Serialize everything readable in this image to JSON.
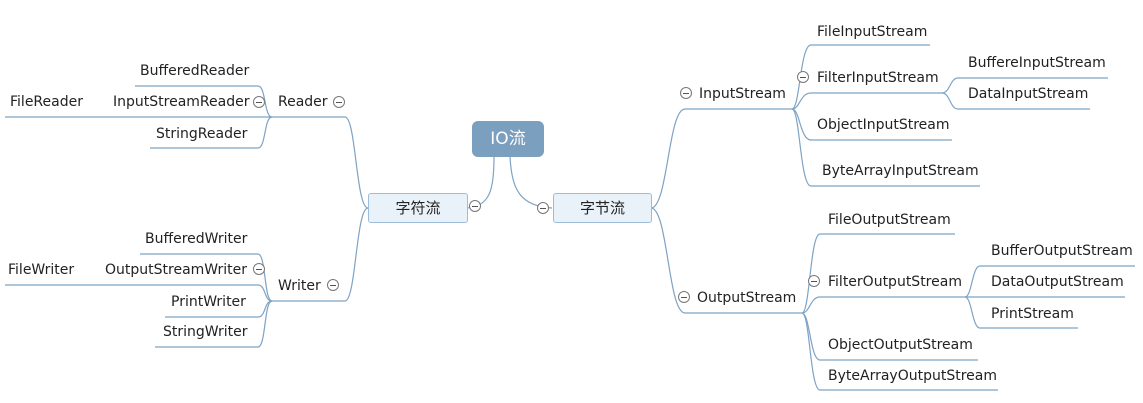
{
  "root": "IO流",
  "char_stream": {
    "label": "字符流",
    "reader": {
      "label": "Reader",
      "children": [
        "BufferedReader",
        "InputStreamReader",
        "StringReader"
      ],
      "input_stream_reader_child": "FileReader"
    },
    "writer": {
      "label": "Writer",
      "children": [
        "BufferedWriter",
        "OutputStreamWriter",
        "PrintWriter",
        "StringWriter"
      ],
      "output_stream_writer_child": "FileWriter"
    }
  },
  "byte_stream": {
    "label": "字节流",
    "input": {
      "label": "InputStream",
      "children": [
        "FileInputStream",
        "FilterInputStream",
        "ObjectInputStream",
        "ByteArrayInputStream"
      ],
      "filter_children": [
        "BuffereInputStream",
        "DataInputStream"
      ]
    },
    "output": {
      "label": "OutputStream",
      "children": [
        "FileOutputStream",
        "FilterOutputStream",
        "ObjectOutputStream",
        "ByteArrayOutputStream"
      ],
      "filter_children": [
        "BufferOutputStream",
        "DataOutputStream",
        "PrintStream"
      ]
    }
  },
  "colors": {
    "root_bg": "#7a9fbf",
    "line": "#7ea3c4",
    "box_bg": "#eaf2f9"
  }
}
